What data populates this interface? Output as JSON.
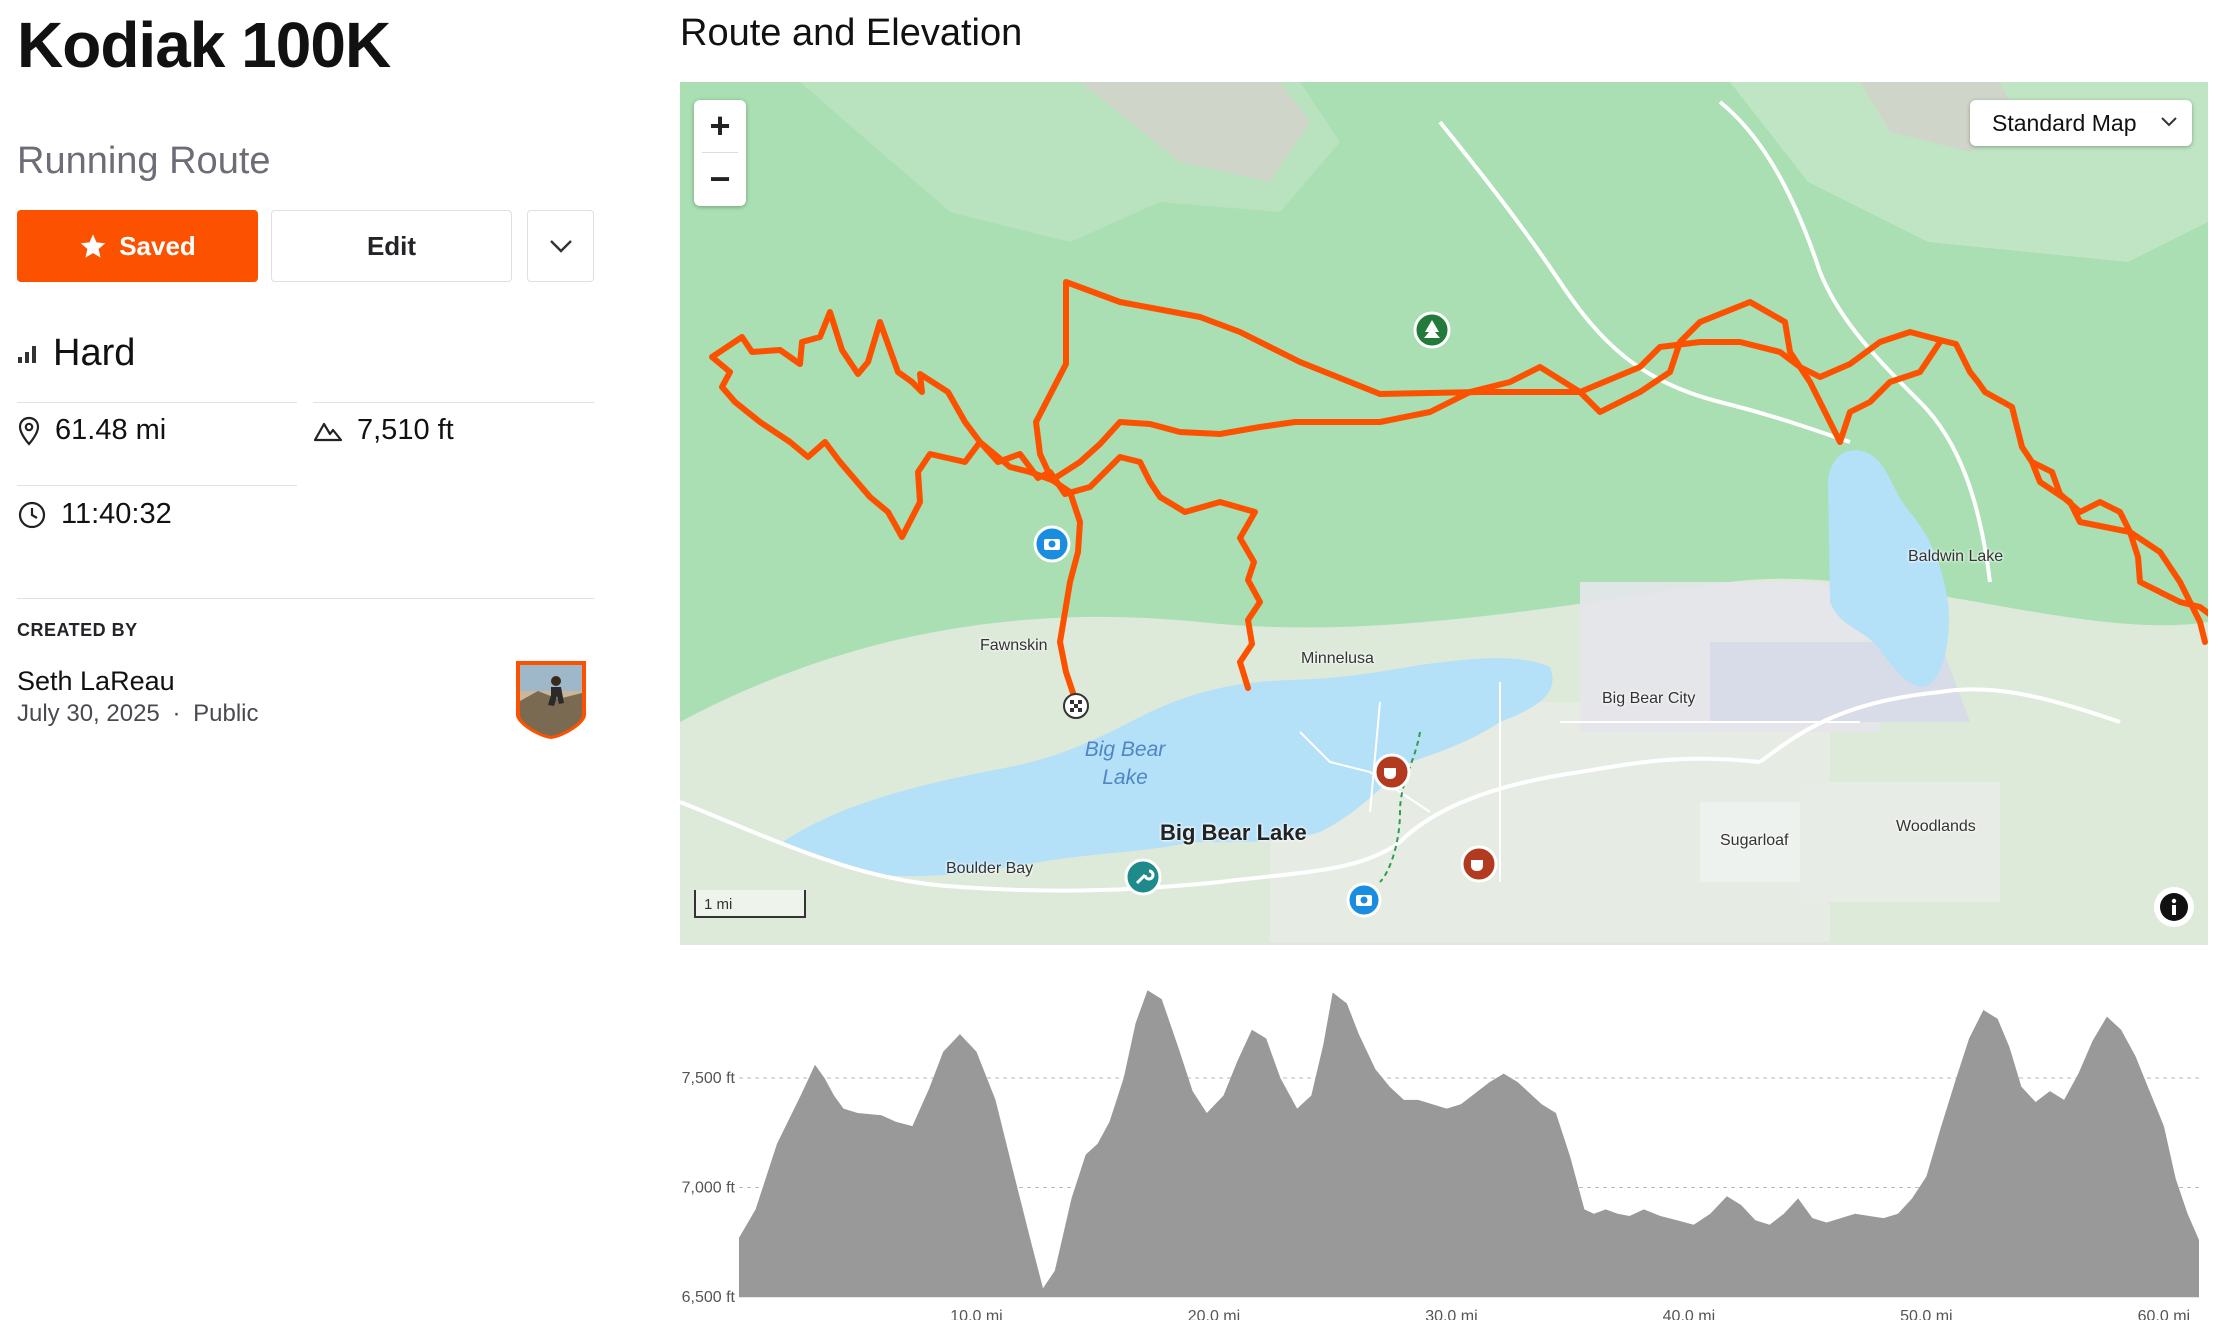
{
  "route": {
    "title": "Kodiak 100K",
    "type": "Running Route",
    "saved_label": "Saved",
    "edit_label": "Edit",
    "difficulty": "Hard",
    "distance": "61.48 mi",
    "elevation_gain": "7,510 ft",
    "est_time": "11:40:32"
  },
  "creator": {
    "heading": "CREATED BY",
    "name": "Seth LaReau",
    "date": "July 30, 2025",
    "visibility": "Public",
    "separator": "·"
  },
  "map": {
    "section_title": "Route and Elevation",
    "style_select": "Standard Map",
    "zoom_in": "+",
    "zoom_out": "−",
    "scale": "1 mi",
    "labels": {
      "fawnskin": "Fawnskin",
      "minnelusa": "Minnelusa",
      "big_bear_city": "Big Bear City",
      "baldwin_lake": "Baldwin Lake",
      "lake_line1": "Big Bear",
      "lake_line2": "Lake",
      "big_bear_lake": "Big Bear Lake",
      "boulder_bay": "Boulder Bay",
      "sugarloaf": "Sugarloaf",
      "woodlands": "Woodlands"
    },
    "colors": {
      "route": "#fc5200",
      "land": "#a9dfb2",
      "water": "#b4e0f8",
      "accent": "#fc5200"
    }
  },
  "chart_data": {
    "type": "area",
    "title": "",
    "xlabel": "",
    "ylabel": "",
    "x_ticks": [
      "10.0 mi",
      "20.0 mi",
      "30.0 mi",
      "40.0 mi",
      "50.0 mi",
      "60.0 mi"
    ],
    "y_ticks": [
      "7,500 ft",
      "7,000 ft",
      "6,500 ft"
    ],
    "xlim": [
      0,
      61.48
    ],
    "ylim": [
      6500,
      7970
    ],
    "grid": "horizontal dashed",
    "series": [
      {
        "x": [
          0,
          0.7,
          1.6,
          2.6,
          3.2,
          3.6,
          4.0,
          4.4,
          5.0,
          6.0,
          6.6,
          7.3,
          8.0,
          8.6,
          9.3,
          10.0,
          10.8,
          11.6,
          12.3,
          12.8,
          13.3,
          14.0,
          14.6,
          15.1,
          15.6,
          16.2,
          16.7,
          17.2,
          17.8,
          18.5,
          19.1,
          19.7,
          20.4,
          21.0,
          21.6,
          22.2,
          22.8,
          23.5,
          24.1,
          24.6,
          25.0,
          25.6,
          26.1,
          26.8,
          27.4,
          28.0,
          28.6,
          29.2,
          29.8,
          30.4,
          31.0,
          31.6,
          32.2,
          32.8,
          33.4,
          33.8,
          34.4,
          35.0,
          35.6,
          36.0,
          36.5,
          37.0,
          37.5,
          38.1,
          38.8,
          39.5,
          40.2,
          40.9,
          41.6,
          42.2,
          42.8,
          43.4,
          44.0,
          44.6,
          45.2,
          45.8,
          46.4,
          47.0,
          47.6,
          48.2,
          48.8,
          49.4,
          50.0,
          50.6,
          51.2,
          51.8,
          52.4,
          53.0,
          53.5,
          54.0,
          54.6,
          55.2,
          55.8,
          56.4,
          57.0,
          57.6,
          58.2,
          58.8,
          59.4,
          60.0,
          60.5,
          61.0,
          61.48
        ],
        "values": [
          6770,
          6900,
          7200,
          7420,
          7560,
          7500,
          7420,
          7360,
          7340,
          7330,
          7300,
          7280,
          7450,
          7620,
          7700,
          7620,
          7400,
          7050,
          6750,
          6540,
          6620,
          6950,
          7150,
          7200,
          7300,
          7500,
          7750,
          7900,
          7860,
          7640,
          7440,
          7340,
          7420,
          7580,
          7720,
          7680,
          7500,
          7360,
          7420,
          7650,
          7890,
          7840,
          7700,
          7540,
          7460,
          7400,
          7400,
          7380,
          7360,
          7380,
          7430,
          7480,
          7520,
          7480,
          7420,
          7380,
          7340,
          7140,
          6900,
          6880,
          6900,
          6880,
          6870,
          6900,
          6870,
          6850,
          6830,
          6880,
          6960,
          6920,
          6850,
          6830,
          6880,
          6950,
          6860,
          6840,
          6860,
          6880,
          6870,
          6860,
          6880,
          6950,
          7050,
          7270,
          7480,
          7680,
          7810,
          7770,
          7640,
          7460,
          7390,
          7440,
          7400,
          7520,
          7670,
          7780,
          7720,
          7600,
          7440,
          7280,
          7040,
          6880,
          6760
        ]
      }
    ]
  }
}
